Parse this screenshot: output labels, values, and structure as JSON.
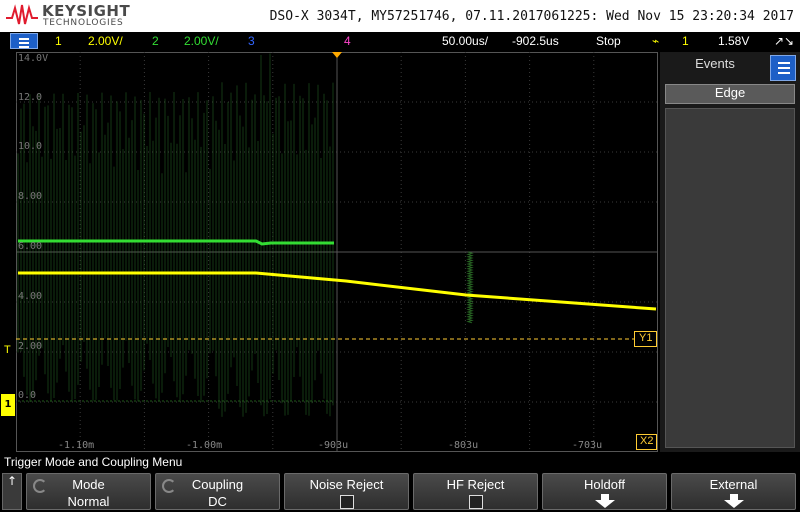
{
  "header": {
    "brand": "KEYSIGHT",
    "brand_sub": "TECHNOLOGIES",
    "info": "DSO-X 3034T, MY57251746, 07.11.2017061225: Wed Nov 15 23:20:34 2017"
  },
  "status": {
    "ch1_num": "1",
    "ch1_scale": "2.00V/",
    "ch2_num": "2",
    "ch2_scale": "2.00V/",
    "ch3_num": "3",
    "ch4_num": "4",
    "timebase": "50.00us/",
    "delay": "-902.5us",
    "run_state": "Stop",
    "trigger_icon": "⌁",
    "trigger_source": "1",
    "trigger_level": "1.58V",
    "trigger_slope_icon": "↗↘"
  },
  "display": {
    "y_labels": [
      "14.0V",
      "12.0",
      "10.0",
      "8.00",
      "6.00",
      "4.00",
      "2.00",
      "0.0"
    ],
    "x_labels": [
      "-1.10m",
      "-1.00m",
      "-903u",
      "-803u",
      "-703u"
    ],
    "trig_level_marker": "T",
    "ground_marker": "1",
    "y1_cursor": "Y1",
    "x2_cursor": "X2"
  },
  "sidebar": {
    "title": "Events",
    "tab": "Edge"
  },
  "menu": {
    "title": "Trigger Mode and Coupling Menu",
    "back_icon": "↑",
    "softkeys": [
      {
        "label": "Mode",
        "value": "Normal"
      },
      {
        "label": "Coupling",
        "value": "DC"
      },
      {
        "label": "Noise Reject",
        "value": ""
      },
      {
        "label": "HF Reject",
        "value": ""
      },
      {
        "label": "Holdoff",
        "value": ""
      },
      {
        "label": "External",
        "value": ""
      }
    ]
  },
  "colors": {
    "ch1": "#ffff00",
    "ch2": "#33dd33",
    "ch3": "#3366ff",
    "ch4": "#ff44cc",
    "cursor": "#ffcc33",
    "accent": "#1d5fc7"
  }
}
